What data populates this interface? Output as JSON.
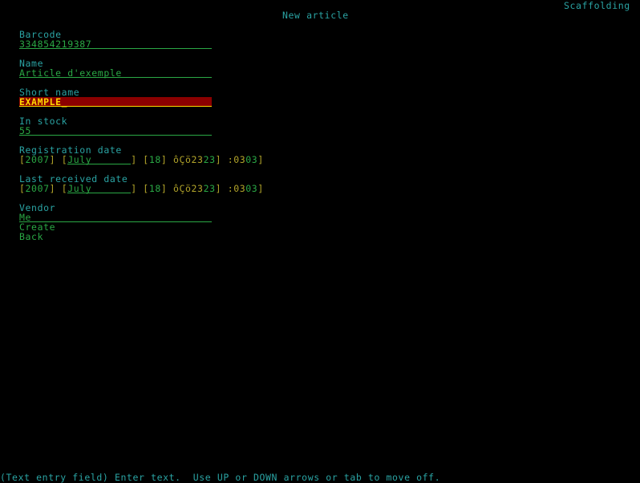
{
  "header": {
    "title": "New article",
    "app_name": "Scaffolding"
  },
  "form": {
    "barcode": {
      "label": "Barcode",
      "value": "334854219387"
    },
    "name": {
      "label": "Name",
      "value": "Article d'exemple"
    },
    "short_name": {
      "label": "Short name",
      "value": "EXAMPLE"
    },
    "in_stock": {
      "label": "In stock",
      "value": "55"
    },
    "registration_date": {
      "label": "Registration date",
      "year": "2007",
      "month": "July",
      "day": "18",
      "hour": "ôÇö23",
      "hour_tail": "23",
      "minute": ":03",
      "minute_tail": "03"
    },
    "last_received_date": {
      "label": "Last received date",
      "year": "2007",
      "month": "July",
      "day": "18",
      "hour": "ôÇö23",
      "hour_tail": "23",
      "minute": ":03",
      "minute_tail": "03"
    },
    "vendor": {
      "label": "Vendor",
      "value": "Me"
    }
  },
  "actions": {
    "create_label": "Create",
    "back_label": "Back"
  },
  "status_bar": {
    "text": "(Text entry field) Enter text.  Use UP or DOWN arrows or tab to move off."
  },
  "colors": {
    "background": "#000000",
    "label": "#2aa3a3",
    "value": "#2aa845",
    "bracket": "#b3a52a",
    "active_bg": "#8b0000",
    "active_text": "#ffd700"
  }
}
